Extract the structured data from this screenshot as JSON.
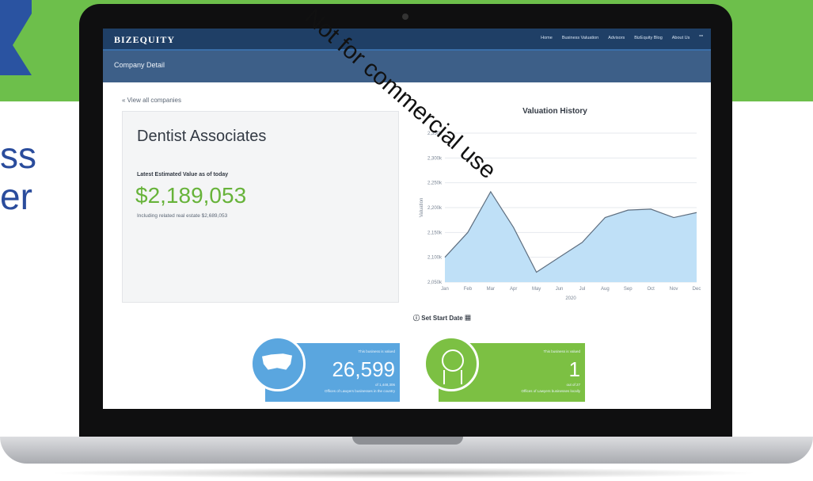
{
  "side_text": {
    "line1": "ss",
    "line2": "er"
  },
  "nav": {
    "logo": "BIZEQUITY",
    "links": [
      "Home",
      "Business Valuation",
      "Advisors",
      "BizEquity Blog",
      "About Us"
    ]
  },
  "subheader": {
    "title": "Company Detail"
  },
  "back_link": "« View all companies",
  "company_card": {
    "name": "Dentist Associates",
    "estimated_label": "Latest Estimated Value as of today",
    "value": "$2,189,053",
    "related": "Including related real estate $2,689,053"
  },
  "chart_data": {
    "type": "area",
    "title": "Valuation History",
    "ylabel": "Valuation",
    "xlabel": "2020",
    "x": [
      "Jan",
      "Feb",
      "Mar",
      "Apr",
      "May",
      "Jun",
      "Jul",
      "Aug",
      "Sep",
      "Oct",
      "Nov",
      "Dec"
    ],
    "y_ticks": [
      "2,050k",
      "2,100k",
      "2,150k",
      "2,200k",
      "2,250k",
      "2,300k",
      "2,350k"
    ],
    "ylim": [
      2050,
      2350
    ],
    "values": [
      2100,
      2150,
      2232,
      2160,
      2070,
      2100,
      2130,
      2180,
      2195,
      2197,
      2180,
      2190
    ]
  },
  "set_start": "Set Start Date",
  "badges": {
    "left": {
      "top": "This business is valued",
      "number": "26,599",
      "sub": "of 1,448,306",
      "desc": "Offices of Lawyers businesses in the country"
    },
    "right": {
      "top": "This business is valued",
      "number": "1",
      "sub": "out of 27",
      "desc": "Offices of Lawyers businesses locally"
    }
  },
  "watermark": "Not for commercial use"
}
